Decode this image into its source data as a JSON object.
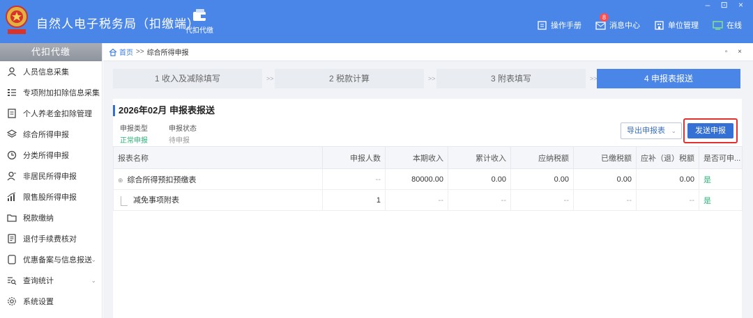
{
  "header": {
    "title": "自然人电子税务局（扣缴端）",
    "module_label": "代扣代缴",
    "window_controls": "– ⊡ ×",
    "links": [
      {
        "label": "操作手册",
        "icon": "manual-icon"
      },
      {
        "label": "消息中心",
        "icon": "mail-icon",
        "badge": "8"
      },
      {
        "label": "单位管理",
        "icon": "building-icon"
      },
      {
        "label": "在线",
        "icon": "monitor-icon"
      }
    ],
    "accent": "#4a86e8"
  },
  "sidebar": {
    "title": "代扣代缴",
    "items": [
      {
        "label": "人员信息采集",
        "icon": "person-icon"
      },
      {
        "label": "专项附加扣除信息采集",
        "icon": "list-icon"
      },
      {
        "label": "个人养老金扣除管理",
        "icon": "document-icon"
      },
      {
        "label": "综合所得申报",
        "icon": "layers-icon"
      },
      {
        "label": "分类所得申报",
        "icon": "clock-icon"
      },
      {
        "label": "非居民所得申报",
        "icon": "person-outline-icon"
      },
      {
        "label": "限售股所得申报",
        "icon": "bar-chart-icon"
      },
      {
        "label": "税款缴纳",
        "icon": "folder-icon"
      },
      {
        "label": "退付手续费核对",
        "icon": "receipt-icon"
      },
      {
        "label": "优惠备案与信息报送",
        "icon": "file-icon",
        "chevron": "⌄"
      },
      {
        "label": "查询统计",
        "icon": "search-list-icon",
        "chevron": "⌄"
      },
      {
        "label": "系统设置",
        "icon": "gear-icon"
      }
    ]
  },
  "breadcrumb": {
    "home": "首页",
    "separator": ">>",
    "current": "综合所得申报",
    "controls": "▫ ×"
  },
  "steps": [
    {
      "label": "1 收入及减除填写",
      "active": false
    },
    {
      "label": "2 税款计算",
      "active": false
    },
    {
      "label": "3 附表填写",
      "active": false
    },
    {
      "label": "4 申报表报送",
      "active": true
    }
  ],
  "step_arrow": ">>",
  "panel": {
    "title": "2026年02月 申报表报送",
    "declare_type_label": "申报类型",
    "declare_type_value": "正常申报",
    "declare_status_label": "申报状态",
    "declare_status_value": "待申报",
    "export_label": "导出申报表",
    "send_label": "发送申报"
  },
  "table": {
    "headers": [
      "报表名称",
      "申报人数",
      "本期收入",
      "累计收入",
      "应纳税额",
      "已缴税额",
      "应补（退）税额",
      "是否可申..."
    ],
    "rows": [
      {
        "name": "综合所得预扣预缴表",
        "count": "--",
        "income": "80000.00",
        "cumulative": "0.00",
        "tax_due": "0.00",
        "tax_paid": "0.00",
        "tax_diff": "0.00",
        "can_declare": "是"
      },
      {
        "name": "减免事项附表",
        "count": "1",
        "income": "--",
        "cumulative": "--",
        "tax_due": "--",
        "tax_paid": "--",
        "tax_diff": "--",
        "can_declare": "是"
      }
    ]
  }
}
